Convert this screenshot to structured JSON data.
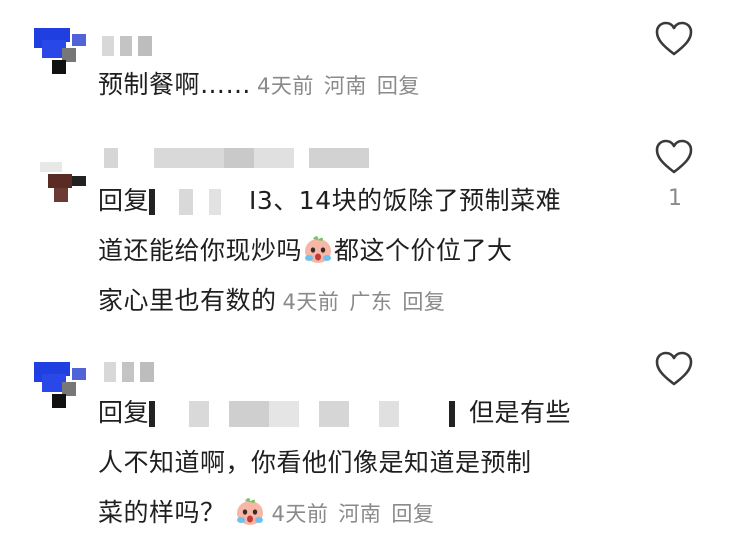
{
  "comments": [
    {
      "text": "预制餐啊……",
      "time": "4天前",
      "location": "河南",
      "reply_label": "回复"
    },
    {
      "text_prefix": "回复",
      "text_main_1": "I3、14块的饭除了预制菜难",
      "text_main_2": "道还能给你现炒吗",
      "text_main_2b": "都这个价位了大",
      "text_main_3": "家心里也有数的",
      "time": "4天前",
      "location": "广东",
      "reply_label": "回复",
      "like_count": "1"
    },
    {
      "text_prefix": "回复",
      "text_main_1": "但是有些",
      "text_main_2": "人不知道啊，你看他们像是知道是预制",
      "text_main_3": "菜的样吗？",
      "time": "4天前",
      "location": "河南",
      "reply_label": "回复"
    }
  ],
  "icons": {
    "like": "heart-outline-icon",
    "emoji": "crying-face-emoji-icon"
  },
  "colors": {
    "meta": "#8a8a8a",
    "avatar_blue": "#1f3fe0",
    "avatar_dark": "#222222"
  }
}
